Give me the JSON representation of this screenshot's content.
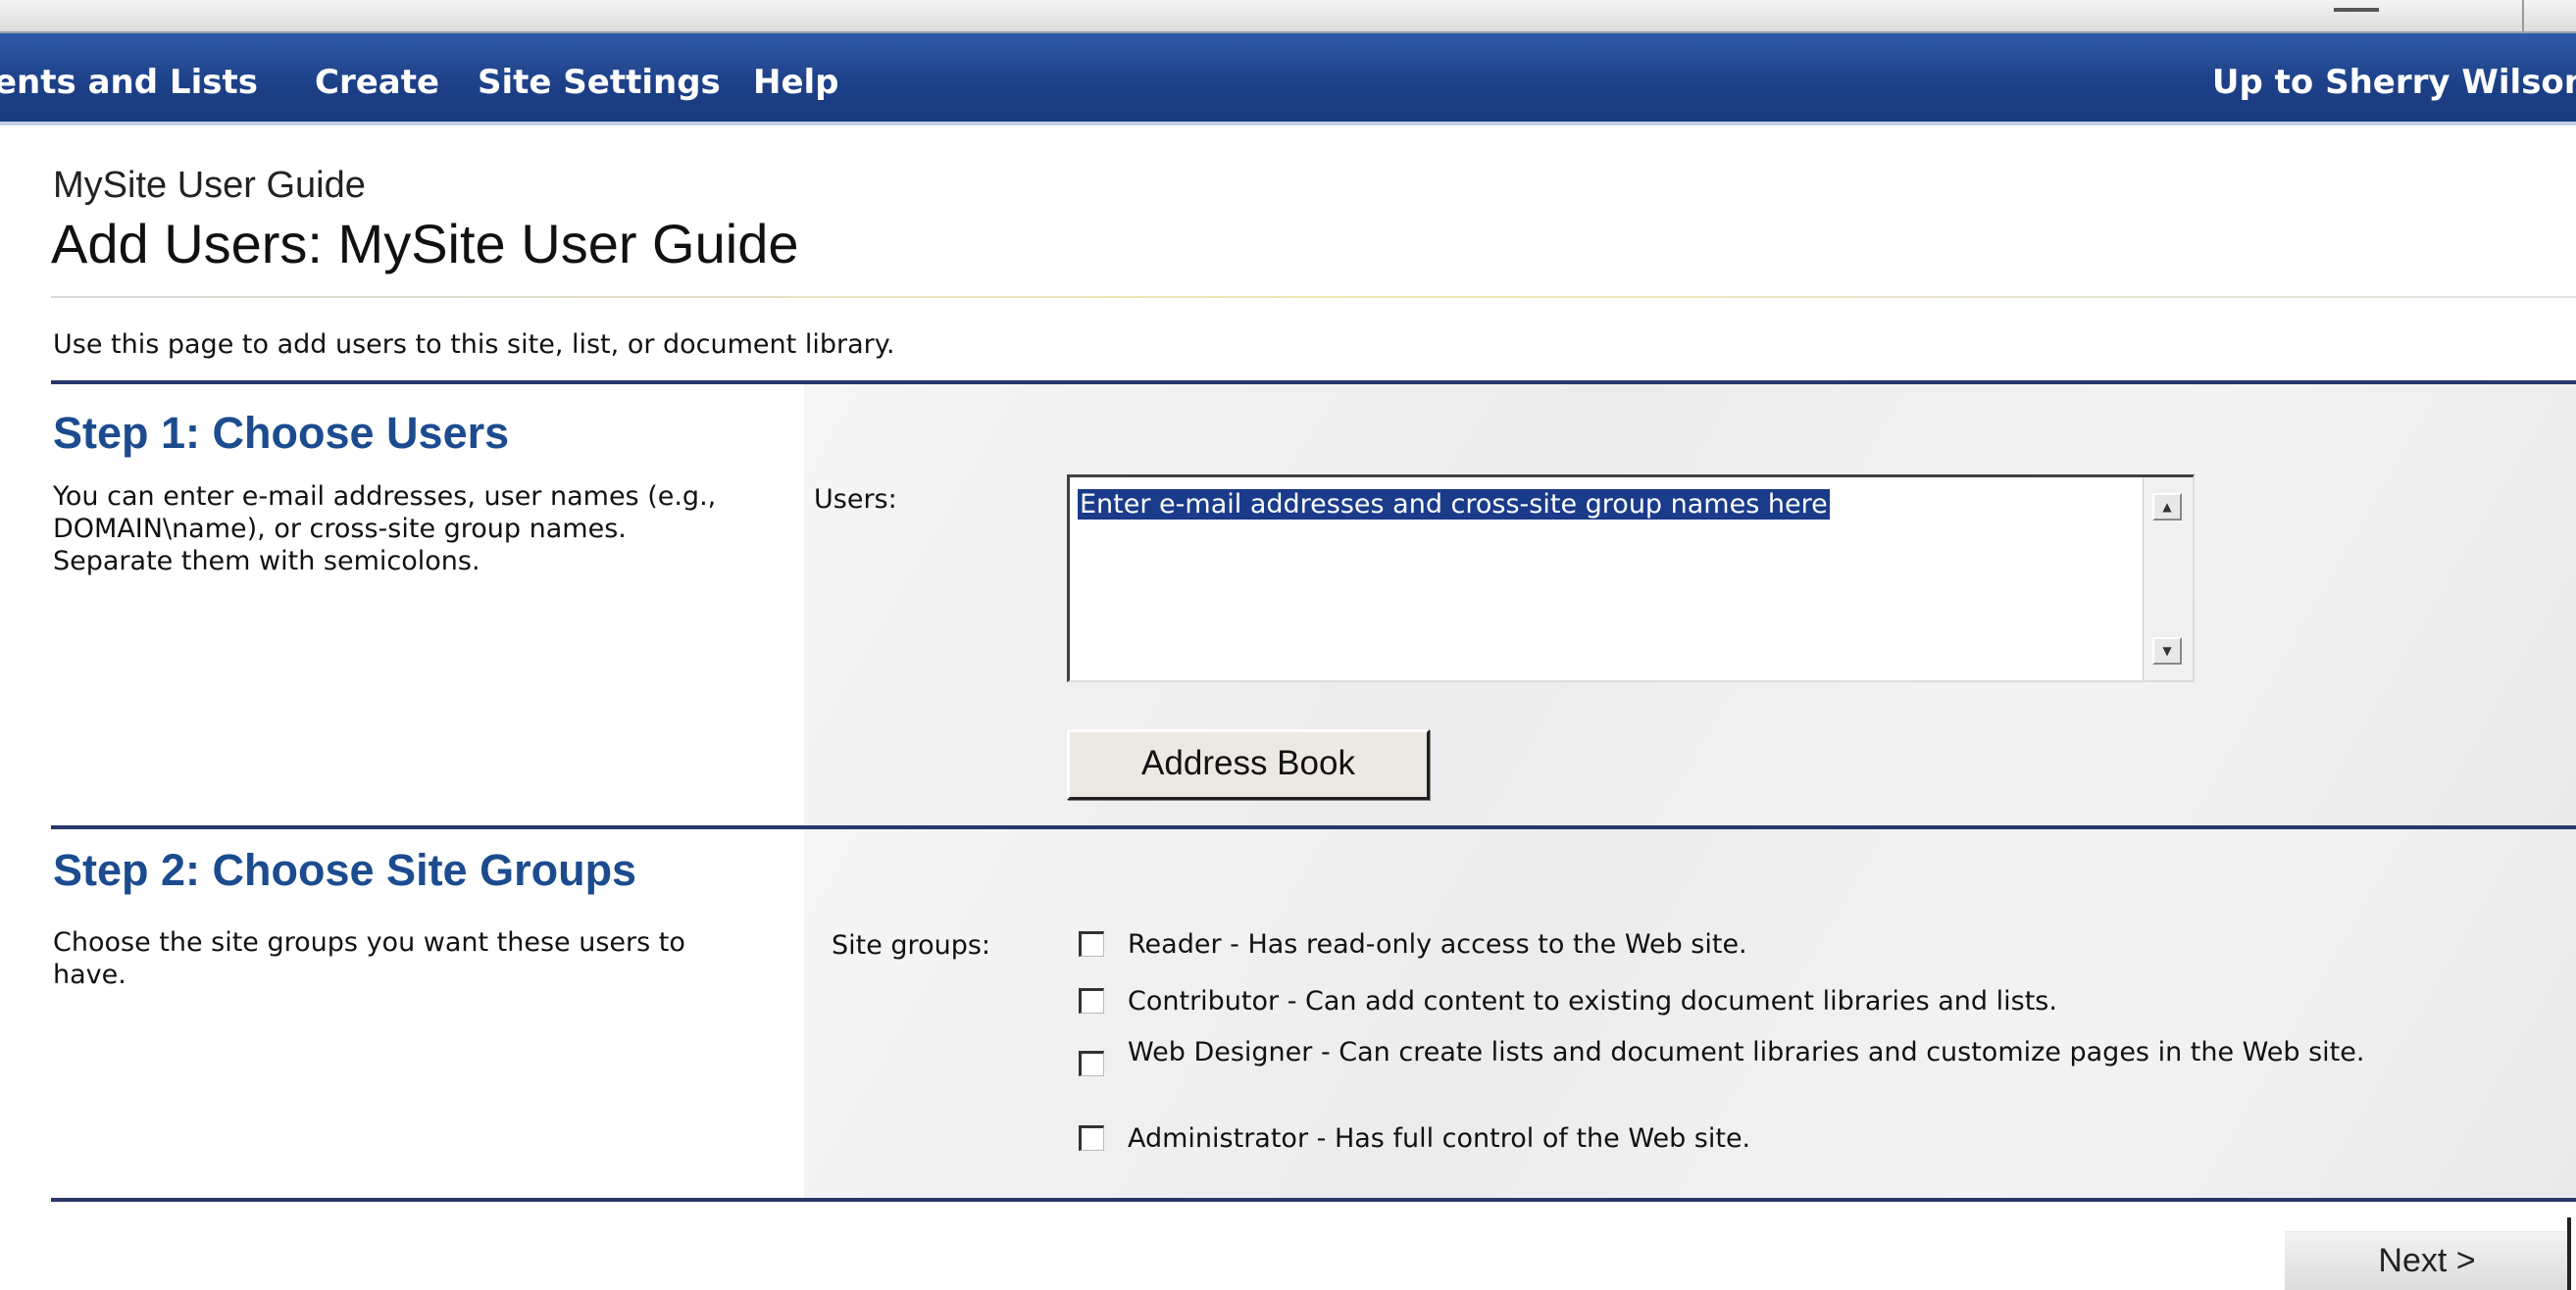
{
  "nav": {
    "items": [
      "ents and Lists",
      "Create",
      "Site Settings",
      "Help"
    ],
    "up_link": "Up to Sherry Wilson"
  },
  "header": {
    "site_name": "MySite User Guide",
    "page_title": "Add Users: MySite User Guide"
  },
  "description": "Use this page to add users to this site, list, or document library.",
  "step1": {
    "heading": "Step 1: Choose Users",
    "description": "You can enter e-mail addresses, user names (e.g., DOMAIN\\name), or cross-site group names. Separate them with semicolons.",
    "users_label": "Users:",
    "users_value": "Enter e-mail addresses and cross-site group names here",
    "address_book_label": "Address Book"
  },
  "step2": {
    "heading": "Step 2: Choose Site Groups",
    "description": "Choose the site groups you want these users to have.",
    "site_groups_label": "Site groups:",
    "options": [
      {
        "label": "Reader - Has read-only access to the Web site.",
        "checked": false
      },
      {
        "label": "Contributor - Can add content to existing document libraries and lists.",
        "checked": false
      },
      {
        "label": "Web Designer - Can create lists and document libraries and customize pages in the Web site.",
        "checked": false
      },
      {
        "label": "Administrator - Has full control of the Web site.",
        "checked": false
      }
    ]
  },
  "footer": {
    "next_label": "Next >"
  },
  "colors": {
    "navbar": "#1c3f86",
    "heading": "#1c4b8f",
    "rule": "#28386a"
  }
}
